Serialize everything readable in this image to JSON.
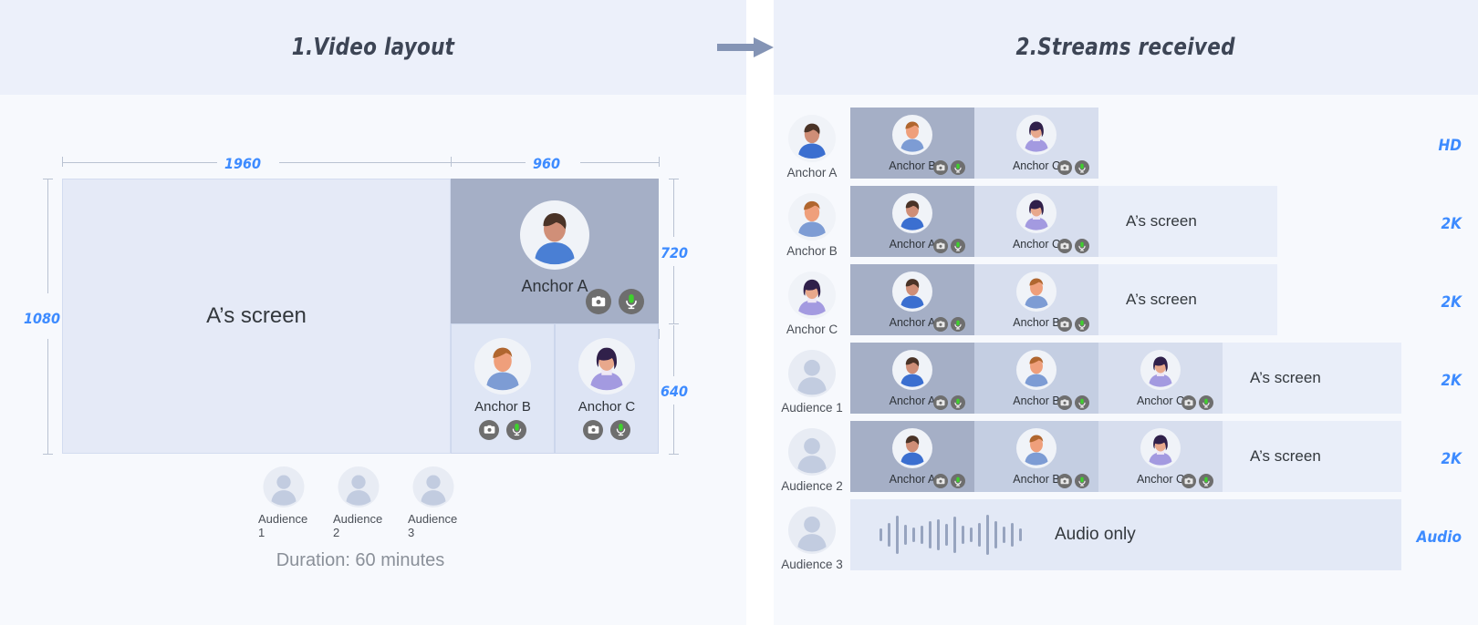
{
  "panels": {
    "left": {
      "title": "1.Video layout"
    },
    "right": {
      "title": "2.Streams received"
    }
  },
  "icons": {
    "flow_arrow": "arrow-right-icon",
    "camera": "camera-icon",
    "microphone": "microphone-icon",
    "avatar": "avatar-icon"
  },
  "colors": {
    "accent_blue": "#3d8bff",
    "header_bg": "#ecf0fa",
    "panel_bg": "#f7f9fd",
    "tile_dark": "#a5afc6",
    "tile_light": "#dfe6f5",
    "screen_fill": "#e5eaf7",
    "badge_bg": "#6e6e6e",
    "mic_green": "#3fd02e",
    "title_text": "#3d4555",
    "muted_text": "#8a9099"
  },
  "layout": {
    "screen_share": {
      "label": "A’s screen"
    },
    "dimensions": {
      "total_width": "1960",
      "right_col_width": "960",
      "total_height": "1080",
      "anchor_a_height": "720",
      "bottom_row_height": "640",
      "anchor_b_width": "480",
      "anchor_c_width": "480"
    },
    "tiles": [
      {
        "name": "Anchor A",
        "camera": true,
        "mic": true
      },
      {
        "name": "Anchor B",
        "camera": true,
        "mic": true
      },
      {
        "name": "Anchor C",
        "camera": true,
        "mic": true
      }
    ],
    "audience": [
      {
        "label": "Audience 1"
      },
      {
        "label": "Audience 2"
      },
      {
        "label": "Audience 3"
      }
    ],
    "duration": "Duration: 60 minutes"
  },
  "streams": {
    "screen_label": "A’s screen",
    "audio_label": "Audio only",
    "rows": [
      {
        "user": "Anchor A",
        "user_type": "anchor",
        "avatar": "anchor-a",
        "cells": [
          {
            "name": "Anchor B",
            "avatar": "anchor-b",
            "shade": "dark",
            "camera": true,
            "mic": true
          },
          {
            "name": "Anchor C",
            "avatar": "anchor-c",
            "shade": "light",
            "camera": true,
            "mic": true
          }
        ],
        "screen": false,
        "quality": "HD"
      },
      {
        "user": "Anchor B",
        "user_type": "anchor",
        "avatar": "anchor-b",
        "cells": [
          {
            "name": "Anchor A",
            "avatar": "anchor-a",
            "shade": "dark",
            "camera": true,
            "mic": true
          },
          {
            "name": "Anchor C",
            "avatar": "anchor-c",
            "shade": "light",
            "camera": true,
            "mic": true
          }
        ],
        "screen": true,
        "quality": "2K"
      },
      {
        "user": "Anchor C",
        "user_type": "anchor",
        "avatar": "anchor-c",
        "cells": [
          {
            "name": "Anchor A",
            "avatar": "anchor-a",
            "shade": "dark",
            "camera": true,
            "mic": true
          },
          {
            "name": "Anchor B",
            "avatar": "anchor-b",
            "shade": "light",
            "camera": true,
            "mic": true
          }
        ],
        "screen": true,
        "quality": "2K"
      },
      {
        "user": "Audience 1",
        "user_type": "audience",
        "avatar": "generic",
        "cells": [
          {
            "name": "Anchor A",
            "avatar": "anchor-a",
            "shade": "dark",
            "camera": true,
            "mic": true
          },
          {
            "name": "Anchor B",
            "avatar": "anchor-b",
            "shade": "mid",
            "camera": true,
            "mic": true
          },
          {
            "name": "Anchor C",
            "avatar": "anchor-c",
            "shade": "light",
            "camera": true,
            "mic": true
          }
        ],
        "screen": true,
        "quality": "2K"
      },
      {
        "user": "Audience 2",
        "user_type": "audience",
        "avatar": "generic",
        "cells": [
          {
            "name": "Anchor A",
            "avatar": "anchor-a",
            "shade": "dark",
            "camera": true,
            "mic": true
          },
          {
            "name": "Anchor B",
            "avatar": "anchor-b",
            "shade": "mid",
            "camera": true,
            "mic": true
          },
          {
            "name": "Anchor C",
            "avatar": "anchor-c",
            "shade": "light",
            "camera": true,
            "mic": true
          }
        ],
        "screen": true,
        "quality": "2K"
      },
      {
        "user": "Audience 3",
        "user_type": "audience",
        "avatar": "generic",
        "cells": [],
        "audio_only": true,
        "quality": "Audio"
      }
    ],
    "waveform": [
      14,
      26,
      42,
      22,
      16,
      20,
      30,
      34,
      24,
      40,
      20,
      16,
      26,
      44,
      30,
      18,
      26,
      14
    ]
  }
}
